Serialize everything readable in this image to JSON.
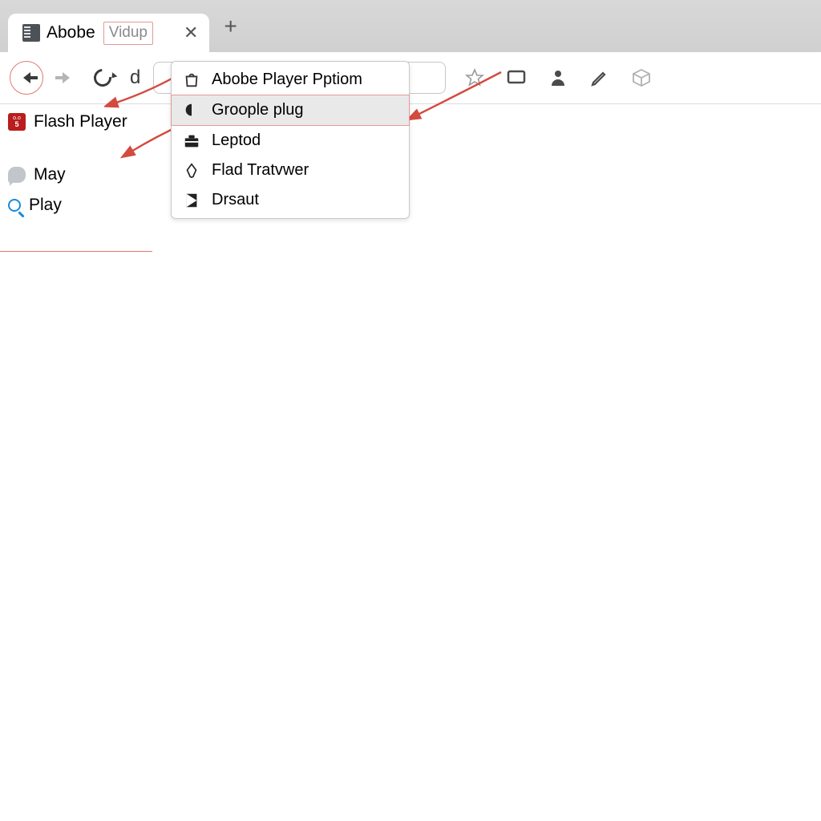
{
  "tab": {
    "title": "Abobe",
    "vidup_label": "Vidup"
  },
  "toolbar": {
    "site_info_glyph": "d"
  },
  "dropdown": {
    "items": [
      {
        "label": "Abobe Player Pptiom"
      },
      {
        "label": "Groople plug"
      },
      {
        "label": "Leptod"
      },
      {
        "label": "Flad Tratvwer"
      },
      {
        "label": "Drsaut"
      }
    ],
    "highlighted_index": 1
  },
  "sidebar": {
    "items": [
      {
        "label": "Flash Player"
      },
      {
        "label": "May"
      },
      {
        "label": "Play"
      }
    ]
  },
  "annotation_color": "#d44a3f"
}
